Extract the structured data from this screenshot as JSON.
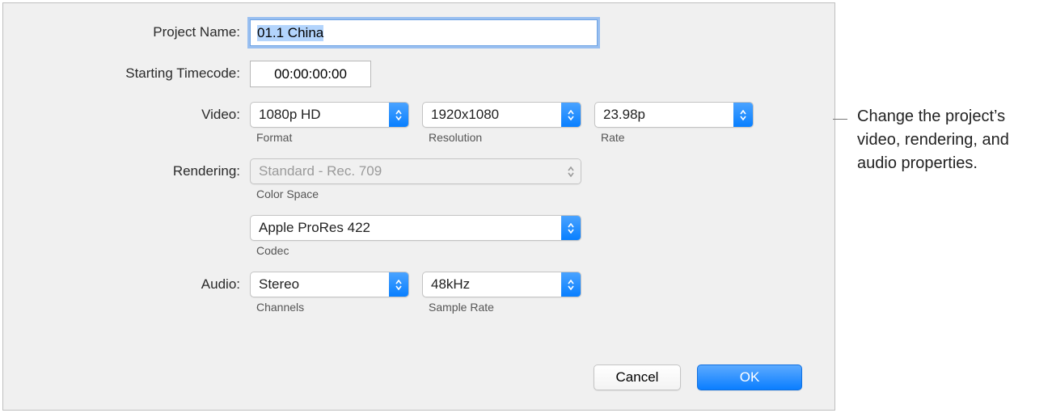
{
  "labels": {
    "project_name": "Project Name:",
    "starting_timecode": "Starting Timecode:",
    "video": "Video:",
    "rendering": "Rendering:",
    "audio": "Audio:"
  },
  "fields": {
    "project_name": {
      "value": "01.1 China"
    },
    "starting_timecode": {
      "value": "00:00:00:00"
    }
  },
  "video": {
    "format": {
      "value": "1080p HD",
      "label": "Format"
    },
    "resolution": {
      "value": "1920x1080",
      "label": "Resolution"
    },
    "rate": {
      "value": "23.98p",
      "label": "Rate"
    }
  },
  "rendering": {
    "color_space": {
      "value": "Standard - Rec. 709",
      "label": "Color Space",
      "disabled": true
    },
    "codec": {
      "value": "Apple ProRes 422",
      "label": "Codec"
    }
  },
  "audio": {
    "channels": {
      "value": "Stereo",
      "label": "Channels"
    },
    "sample_rate": {
      "value": "48kHz",
      "label": "Sample Rate"
    }
  },
  "buttons": {
    "cancel": "Cancel",
    "ok": "OK"
  },
  "callout": "Change the project’s video, rendering, and audio properties."
}
